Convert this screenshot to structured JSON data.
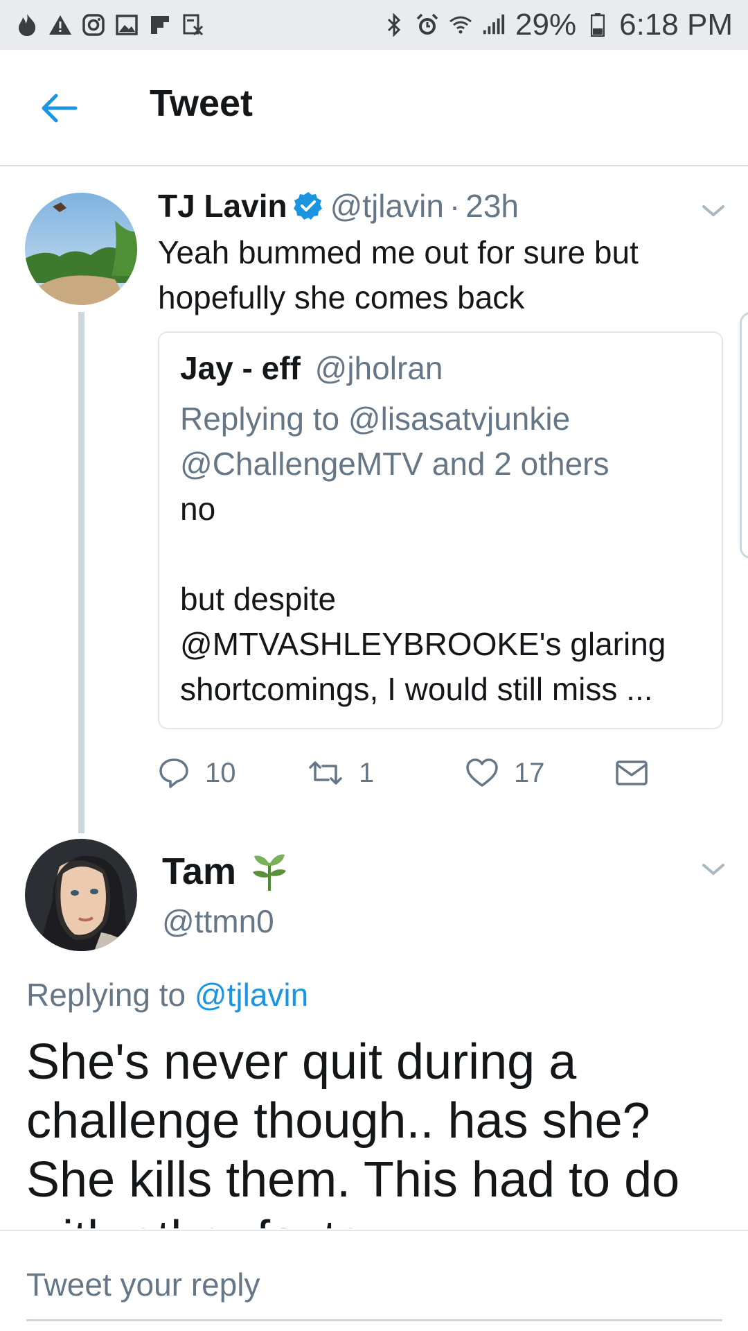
{
  "status_bar": {
    "icons_left": [
      "tinder-flame-icon",
      "warning-icon",
      "instagram-icon",
      "gallery-icon",
      "flipboard-icon",
      "data-saver-icon"
    ],
    "icons_right": [
      "bluetooth-icon",
      "alarm-icon",
      "wifi-icon",
      "signal-icon",
      "battery-icon"
    ],
    "battery": "29%",
    "time": "6:18 PM"
  },
  "header": {
    "title": "Tweet",
    "back_icon": "back-arrow-icon"
  },
  "tweet1": {
    "name": "TJ Lavin",
    "handle": "@tjlavin",
    "age": "23h",
    "separator": "·",
    "text": "Yeah bummed me out for sure but hopefully she comes back",
    "quoted": {
      "name": "Jay - eff",
      "handle": "@jholran",
      "replying_prefix": "Replying to ",
      "replying_to": "@lisasatvjunkie @ChallengeMTV and 2 others",
      "text_line1": "no",
      "text_line2": "but despite @MTVASHLEYBROOKE's glaring shortcomings, I would still miss ..."
    },
    "actions": {
      "replies": "10",
      "retweets": "1",
      "likes": "17"
    }
  },
  "tweet2": {
    "name": "Tam",
    "name_emoji": "seedling-icon",
    "handle": "@ttmn0",
    "replying_prefix": "Replying to ",
    "replying_to": "@tjlavin",
    "text": "She's never quit during a challenge though.. has she? She kills them. This had to do with other factors."
  },
  "composer": {
    "placeholder": "Tweet your reply"
  },
  "colors": {
    "accent": "#1b95e0",
    "muted": "#657786",
    "text": "#14171a",
    "statusbar": "#e9ebee"
  }
}
